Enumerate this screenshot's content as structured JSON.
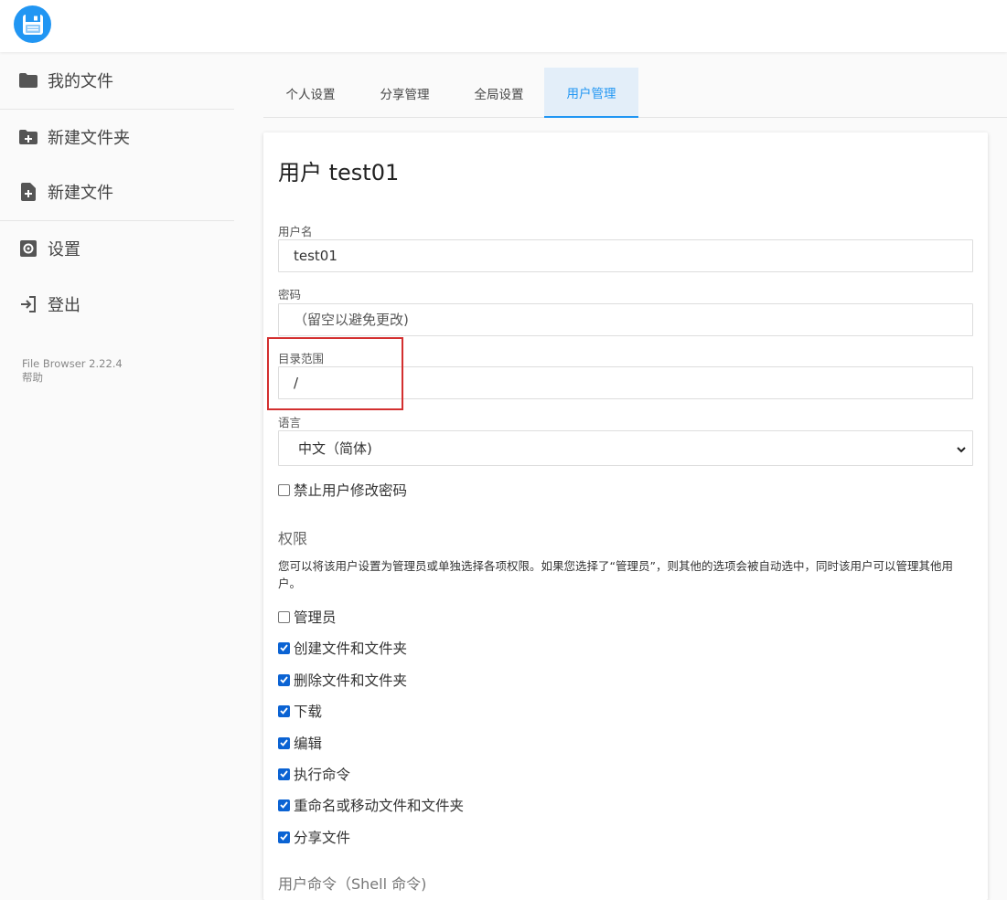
{
  "sidebar": {
    "items": [
      {
        "label": "我的文件",
        "icon": "folder-icon"
      },
      {
        "label": "新建文件夹",
        "icon": "folder-plus-icon"
      },
      {
        "label": "新建文件",
        "icon": "file-plus-icon"
      },
      {
        "label": "设置",
        "icon": "gear-icon"
      },
      {
        "label": "登出",
        "icon": "logout-icon"
      }
    ],
    "version": "File Browser 2.22.4",
    "help": "帮助"
  },
  "tabs": [
    {
      "label": "个人设置"
    },
    {
      "label": "分享管理"
    },
    {
      "label": "全局设置"
    },
    {
      "label": "用户管理",
      "active": true
    }
  ],
  "form": {
    "title": "用户 test01",
    "username_label": "用户名",
    "username_value": "test01",
    "password_label": "密码",
    "password_placeholder": "（留空以避免更改)",
    "scope_label": "目录范围",
    "scope_value": "/",
    "language_label": "语言",
    "language_value": "中文（简体)",
    "lock_password_label": "禁止用户修改密码",
    "lock_password_checked": false
  },
  "permissions": {
    "title": "权限",
    "description": "您可以将该用户设置为管理员或单独选择各项权限。如果您选择了“管理员”，则其他的选项会被自动选中，同时该用户可以管理其他用户。",
    "items": [
      {
        "label": "管理员",
        "checked": false
      },
      {
        "label": "创建文件和文件夹",
        "checked": true
      },
      {
        "label": "删除文件和文件夹",
        "checked": true
      },
      {
        "label": "下载",
        "checked": true
      },
      {
        "label": "编辑",
        "checked": true
      },
      {
        "label": "执行命令",
        "checked": true
      },
      {
        "label": "重命名或移动文件和文件夹",
        "checked": true
      },
      {
        "label": "分享文件",
        "checked": true
      }
    ]
  },
  "commands": {
    "title": "用户命令（Shell 命令)"
  },
  "colors": {
    "accent": "#2196f3",
    "checkbox": "#0b63d3",
    "highlight_box": "#d32f2f"
  }
}
